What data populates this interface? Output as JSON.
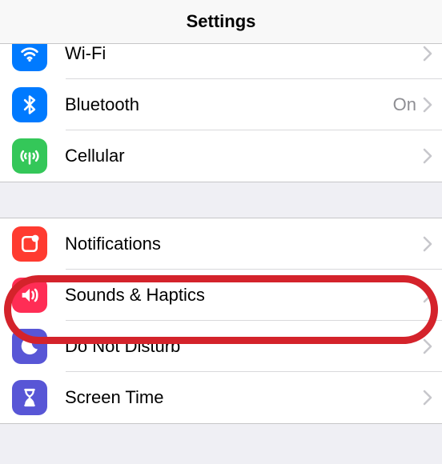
{
  "header": {
    "title": "Settings"
  },
  "group1": {
    "items": [
      {
        "id": "wifi",
        "label": "Wi-Fi",
        "detail": "",
        "color": "#007aff",
        "icon": "wifi-icon"
      },
      {
        "id": "bluetooth",
        "label": "Bluetooth",
        "detail": "On",
        "color": "#007aff",
        "icon": "bluetooth-icon"
      },
      {
        "id": "cellular",
        "label": "Cellular",
        "detail": "",
        "color": "#34c759",
        "icon": "cellular-icon"
      }
    ]
  },
  "group2": {
    "items": [
      {
        "id": "notifications",
        "label": "Notifications",
        "detail": "",
        "color": "#ff3b30",
        "icon": "notifications-icon"
      },
      {
        "id": "sounds",
        "label": "Sounds & Haptics",
        "detail": "",
        "color": "#ff2d55",
        "icon": "sounds-icon",
        "highlighted": true
      },
      {
        "id": "dnd",
        "label": "Do Not Disturb",
        "detail": "",
        "color": "#5856d6",
        "icon": "dnd-icon"
      },
      {
        "id": "screentime",
        "label": "Screen Time",
        "detail": "",
        "color": "#5856d6",
        "icon": "screentime-icon"
      }
    ]
  }
}
